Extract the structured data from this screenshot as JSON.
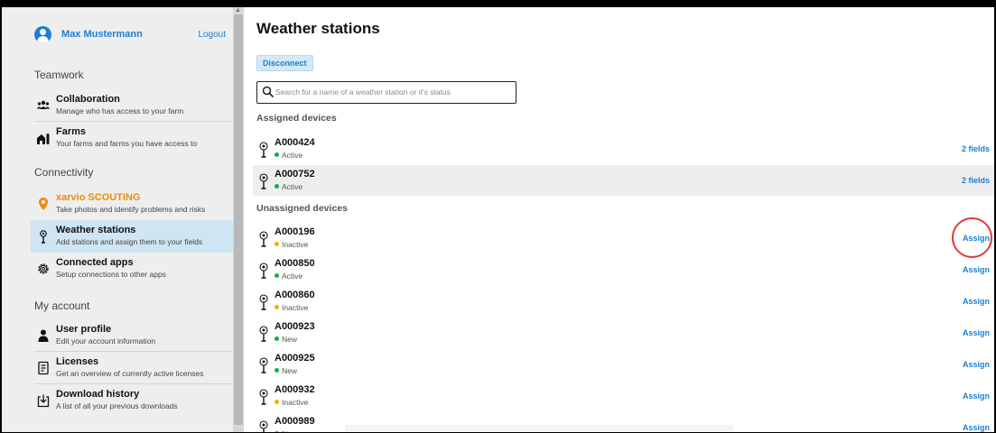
{
  "user": {
    "name": "Max Mustermann",
    "logout": "Logout"
  },
  "sidebar": {
    "sections": [
      {
        "heading": "Teamwork"
      },
      {
        "heading": "Connectivity"
      },
      {
        "heading": "My account"
      }
    ],
    "items": [
      {
        "title": "Collaboration",
        "subtitle": "Manage who has access to your farm",
        "icon": "people-icon"
      },
      {
        "title": "Farms",
        "subtitle": "Your farms and farms you have access to",
        "icon": "farm-icon"
      },
      {
        "title": "xarvio SCOUTING",
        "subtitle": "Take photos and identify problems and risks",
        "icon": "location-pin-icon"
      },
      {
        "title": "Weather stations",
        "subtitle": "Add stations and assign them to your fields",
        "icon": "weather-station-icon"
      },
      {
        "title": "Connected apps",
        "subtitle": "Setup connections to other apps",
        "icon": "gear-icon"
      },
      {
        "title": "User profile",
        "subtitle": "Edit your account information",
        "icon": "person-icon"
      },
      {
        "title": "Licenses",
        "subtitle": "Get an overview of currently active licenses",
        "icon": "license-icon"
      },
      {
        "title": "Download history",
        "subtitle": "A list of all your previous downloads",
        "icon": "download-icon"
      }
    ]
  },
  "main": {
    "title": "Weather stations",
    "disconnect_label": "Disconnect",
    "search_placeholder": "Search for a name of a weather station or it's status",
    "assigned_heading": "Assigned devices",
    "unassigned_heading": "Unassigned devices",
    "assigned": [
      {
        "name": "A000424",
        "status": "Active",
        "action": "2 fields"
      },
      {
        "name": "A000752",
        "status": "Active",
        "action": "2 fields"
      }
    ],
    "unassigned": [
      {
        "name": "A000196",
        "status": "Inactive",
        "action": "Assign"
      },
      {
        "name": "A000850",
        "status": "Active",
        "action": "Assign"
      },
      {
        "name": "A000860",
        "status": "Inactive",
        "action": "Assign"
      },
      {
        "name": "A000923",
        "status": "New",
        "action": "Assign"
      },
      {
        "name": "A000925",
        "status": "New",
        "action": "Assign"
      },
      {
        "name": "A000932",
        "status": "Inactive",
        "action": "Assign"
      },
      {
        "name": "A000989",
        "status": "New",
        "action": "Assign"
      }
    ]
  },
  "colors": {
    "accent": "#1a7fd6",
    "active": "#1fa64a",
    "inactive": "#f0b400",
    "new": "#1fa64a",
    "highlight": "#e53b3b",
    "scouting": "#ef8b0c"
  }
}
